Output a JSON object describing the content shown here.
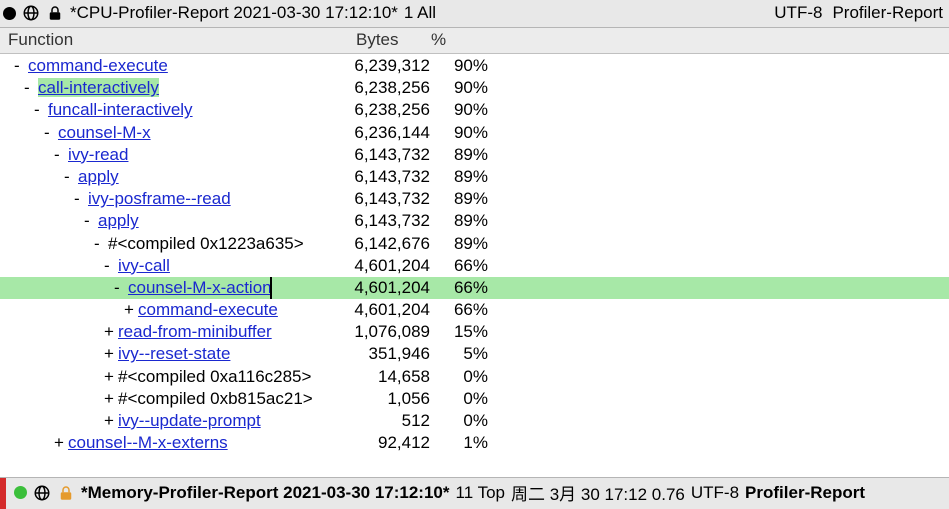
{
  "top": {
    "title": "*CPU-Profiler-Report 2021-03-30 17:12:10*",
    "line_all": "1 All",
    "encoding": "UTF-8",
    "mode": "Profiler-Report"
  },
  "columns": {
    "function": "Function",
    "bytes": "Bytes",
    "percent": "%"
  },
  "rows": [
    {
      "depth": 0,
      "sign": "-",
      "label": "command-execute",
      "link": true,
      "bytes": "6,239,312",
      "pct": "90%"
    },
    {
      "depth": 1,
      "sign": "-",
      "label": "call-interactively",
      "link": true,
      "bytes": "6,238,256",
      "pct": "90%",
      "hl": "token"
    },
    {
      "depth": 2,
      "sign": "-",
      "label": "funcall-interactively",
      "link": true,
      "bytes": "6,238,256",
      "pct": "90%"
    },
    {
      "depth": 3,
      "sign": "-",
      "label": "counsel-M-x",
      "link": true,
      "bytes": "6,236,144",
      "pct": "90%"
    },
    {
      "depth": 4,
      "sign": "-",
      "label": "ivy-read",
      "link": true,
      "bytes": "6,143,732",
      "pct": "89%"
    },
    {
      "depth": 5,
      "sign": "-",
      "label": "apply",
      "link": true,
      "bytes": "6,143,732",
      "pct": "89%"
    },
    {
      "depth": 6,
      "sign": "-",
      "label": "ivy-posframe--read",
      "link": true,
      "bytes": "6,143,732",
      "pct": "89%"
    },
    {
      "depth": 7,
      "sign": "-",
      "label": "apply",
      "link": true,
      "bytes": "6,143,732",
      "pct": "89%"
    },
    {
      "depth": 8,
      "sign": "-",
      "label": "#<compiled 0x1223a635>",
      "link": false,
      "bytes": "6,142,676",
      "pct": "89%"
    },
    {
      "depth": 9,
      "sign": "-",
      "label": "ivy-call",
      "link": true,
      "bytes": "4,601,204",
      "pct": "66%"
    },
    {
      "depth": 10,
      "sign": "-",
      "label": "counsel-M-x-action",
      "link": true,
      "bytes": "4,601,204",
      "pct": "66%",
      "hl": "row",
      "cursor": true
    },
    {
      "depth": 11,
      "sign": "+",
      "label": "command-execute",
      "link": true,
      "bytes": "4,601,204",
      "pct": "66%"
    },
    {
      "depth": 9,
      "sign": "+",
      "label": "read-from-minibuffer",
      "link": true,
      "bytes": "1,076,089",
      "pct": "15%"
    },
    {
      "depth": 9,
      "sign": "+",
      "label": "ivy--reset-state",
      "link": true,
      "bytes": "351,946",
      "pct": "5%"
    },
    {
      "depth": 9,
      "sign": "+",
      "label": "#<compiled 0xa116c285>",
      "link": false,
      "bytes": "14,658",
      "pct": "0%"
    },
    {
      "depth": 9,
      "sign": "+",
      "label": "#<compiled 0xb815ac21>",
      "link": false,
      "bytes": "1,056",
      "pct": "0%"
    },
    {
      "depth": 9,
      "sign": "+",
      "label": "ivy--update-prompt",
      "link": true,
      "bytes": "512",
      "pct": "0%"
    },
    {
      "depth": 4,
      "sign": "+",
      "label": "counsel--M-x-externs",
      "link": true,
      "bytes": "92,412",
      "pct": "1%"
    }
  ],
  "bottom": {
    "title": "*Memory-Profiler-Report 2021-03-30 17:12:10*",
    "pos": "11 Top",
    "date": "周二 3月 30 17:12 0.76",
    "encoding": "UTF-8",
    "mode": "Profiler-Report"
  }
}
